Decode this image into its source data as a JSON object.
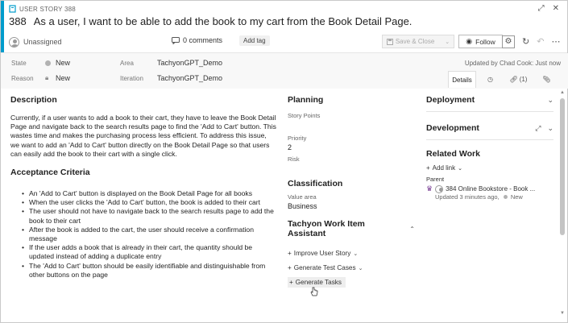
{
  "header": {
    "type_label": "USER STORY 388",
    "id": "388",
    "title": "As a user, I want to be able to add the book to my cart from the Book Detail Page.",
    "assignee": "Unassigned",
    "comments": "0 comments",
    "add_tag": "Add tag",
    "save_close": "Save & Close",
    "follow": "Follow"
  },
  "fields": {
    "state_label": "State",
    "state_value": "New",
    "reason_label": "Reason",
    "reason_value": "New",
    "area_label": "Area",
    "area_value": "TachyonGPT_Demo",
    "iteration_label": "Iteration",
    "iteration_value": "TachyonGPT_Demo",
    "updated_by": "Updated by Chad Cook: Just now"
  },
  "tabs": [
    {
      "label": "Details"
    },
    {
      "label": ""
    },
    {
      "label": "(1)"
    },
    {
      "label": ""
    }
  ],
  "description": {
    "heading": "Description",
    "text": "Currently, if a user wants to add a book to their cart, they have to leave the Book Detail Page and navigate back to the search results page to find the 'Add to Cart' button. This wastes time and makes the purchasing process less efficient. To address this issue, we want to add an 'Add to Cart' button directly on the Book Detail Page so that users can easily add the book to their cart with a single click."
  },
  "acceptance": {
    "heading": "Acceptance Criteria",
    "items": [
      "An 'Add to Cart' button is displayed on the Book Detail Page for all books",
      "When the user clicks the 'Add to Cart' button, the book is added to their cart",
      "The user should not have to navigate back to the search results page to add the book to their cart",
      "After the book is added to the cart, the user should receive a confirmation message",
      "If the user adds a book that is already in their cart, the quantity should be updated instead of adding a duplicate entry",
      "The 'Add to Cart' button should be easily identifiable and distinguishable from other buttons on the page"
    ]
  },
  "planning": {
    "heading": "Planning",
    "story_points_label": "Story Points",
    "story_points_value": "",
    "priority_label": "Priority",
    "priority_value": "2",
    "risk_label": "Risk",
    "risk_value": ""
  },
  "classification": {
    "heading": "Classification",
    "value_area_label": "Value area",
    "value_area_value": "Business"
  },
  "assistant": {
    "heading": "Tachyon Work Item Assistant",
    "actions": [
      "Improve User Story",
      "Generate Test Cases",
      "Generate Tasks"
    ]
  },
  "right": {
    "deployment": "Deployment",
    "development": "Development",
    "related_work": "Related Work",
    "add_link": "Add link",
    "parent_label": "Parent",
    "parent_item": "384 Online Bookstore - Book ...",
    "parent_updated": "Updated 3 minutes ago,",
    "parent_state": "New"
  },
  "colors": {
    "accent": "#009ccc",
    "state_dot": "#b2b2b2",
    "parent_icon": "#773b93"
  }
}
